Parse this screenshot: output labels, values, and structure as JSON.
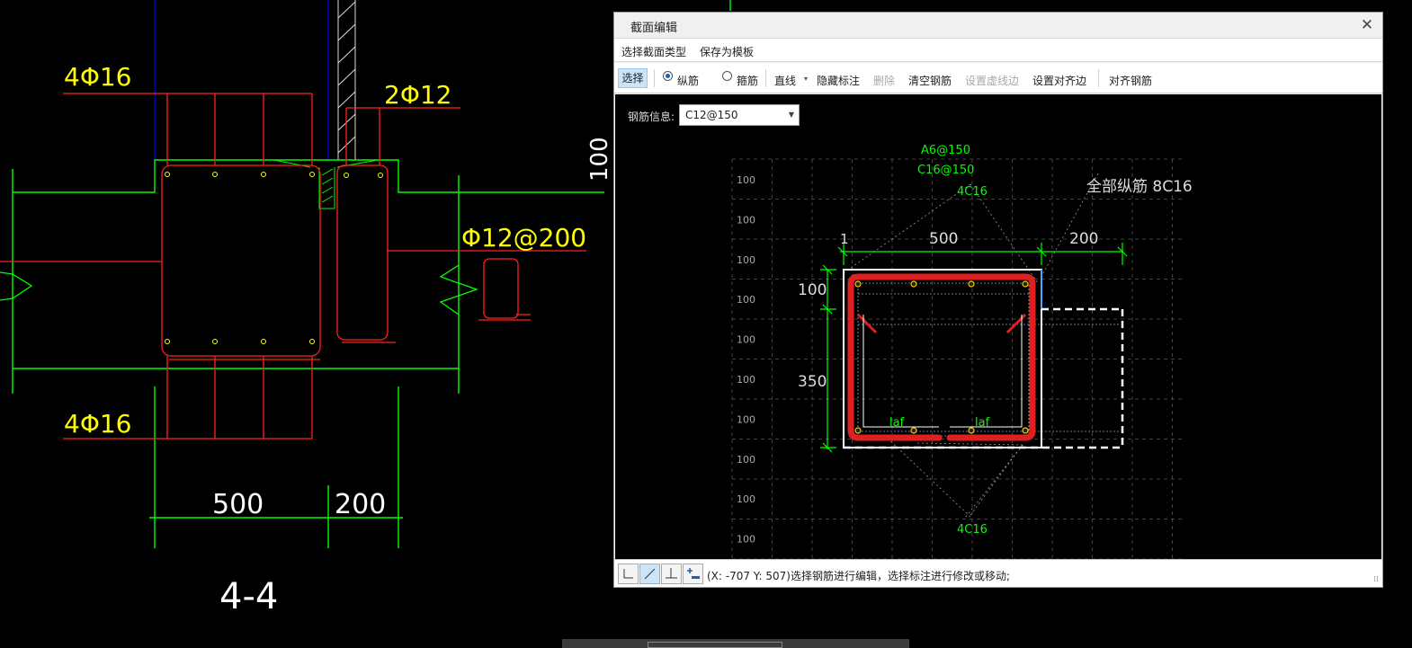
{
  "drawing": {
    "label_4phi16_top": "4Φ16",
    "label_2phi12": "2Φ12",
    "label_phi12_200": "Φ12@200",
    "label_100": "100",
    "label_4phi16_bottom": "4Φ16",
    "dim_500": "500",
    "dim_200": "200",
    "section_label": "4-4"
  },
  "dialog": {
    "title": "截面编辑",
    "close_icon": "close-icon",
    "menu": {
      "section_type": "选择截面类型",
      "save_template": "保存为模板"
    },
    "toolbar": {
      "select": "选择",
      "longitudinal": "纵筋",
      "stirrup": "箍筋",
      "line": "直线",
      "hide_dims": "隐藏标注",
      "delete": "删除",
      "clear_rebar": "清空钢筋",
      "set_dashed": "设置虚线边",
      "set_align_edge": "设置对齐边",
      "align_rebar": "对齐钢筋",
      "longitudinal_checked": true
    },
    "rebar_info": {
      "label": "钢筋信息:",
      "value": "C12@150"
    },
    "section": {
      "grid_label": "100",
      "annot_a6": "A6@150",
      "annot_c16": "C16@150",
      "annot_4c16_top": "4C16",
      "all_long": "全部纵筋  8C16",
      "dim_1": "1",
      "dim_500": "500",
      "dim_200": "200",
      "dim_100": "100",
      "dim_350": "350",
      "laf_left": "laf",
      "laf_right": "laf",
      "annot_4c16_bottom": "4C16"
    },
    "status": {
      "text": "(X: -707 Y: 507)选择钢筋进行编辑，选择标注进行修改或移动;"
    }
  },
  "colors": {
    "cad_green": "#00ff00",
    "cad_yellow": "#ffff00",
    "cad_red": "#ff0000",
    "cad_blue": "#0000ff",
    "rebar_red": "#e02020"
  }
}
